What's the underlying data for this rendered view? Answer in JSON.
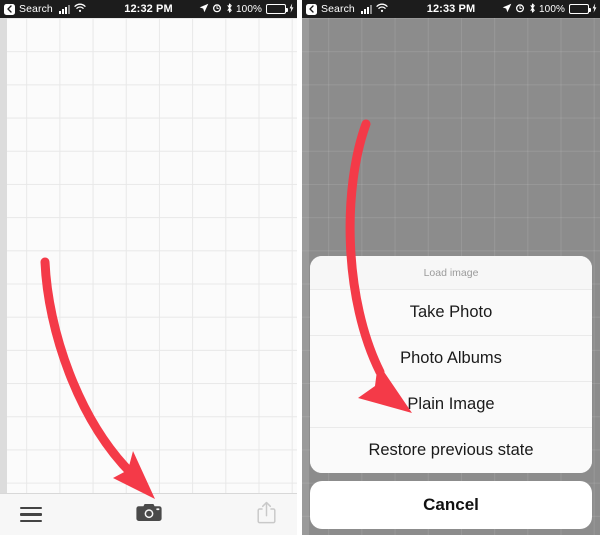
{
  "theme": {
    "arrow_red": "#F43A48",
    "status_bar_bg": "#1c1c1c",
    "battery_green": "#4CD964",
    "canvas_bg": "#FBFBFB",
    "grid_line": "#E8E8E8",
    "dim_overlay": "#8C8C8C",
    "sheet_bg": "#FAFAFA",
    "sheet_title_color": "#9B9B9B"
  },
  "left_screen": {
    "status_bar": {
      "back_label": "Search",
      "time": "12:32 PM",
      "battery_percent": "100%",
      "icons": [
        "back-chevron-icon",
        "cellular-signal-icon",
        "wifi-icon",
        "location-arrow-icon",
        "alarm-clock-icon",
        "bluetooth-icon",
        "battery-icon",
        "charging-bolt-icon"
      ]
    },
    "toolbar": {
      "menu_label": "Menu",
      "camera_label": "Camera",
      "share_label": "Share"
    },
    "annotation": {
      "arrow_label": "curved arrow pointing to camera button"
    }
  },
  "right_screen": {
    "status_bar": {
      "back_label": "Search",
      "time": "12:33 PM",
      "battery_percent": "100%",
      "icons": [
        "back-chevron-icon",
        "cellular-signal-icon",
        "wifi-icon",
        "location-arrow-icon",
        "alarm-clock-icon",
        "bluetooth-icon",
        "battery-icon",
        "charging-bolt-icon"
      ]
    },
    "action_sheet": {
      "title": "Load image",
      "items": [
        {
          "label": "Take Photo"
        },
        {
          "label": "Photo Albums"
        },
        {
          "label": "Plain Image"
        },
        {
          "label": "Restore previous state"
        }
      ],
      "cancel_label": "Cancel"
    },
    "annotation": {
      "arrow_label": "curved arrow pointing to Plain Image"
    }
  }
}
